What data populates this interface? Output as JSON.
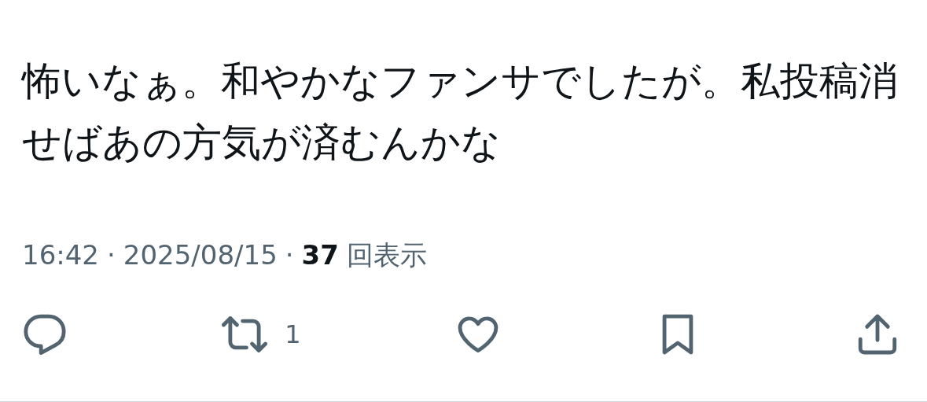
{
  "post": {
    "text": "怖いなぁ。和やかなファンサでしたが。私投稿消せばあの方気が済むんかな"
  },
  "meta": [
    {
      "kind": "time",
      "text": "16:42"
    },
    {
      "kind": "separator",
      "text": "·"
    },
    {
      "kind": "date",
      "text": "2025/08/15"
    },
    {
      "kind": "separator",
      "text": "·"
    },
    {
      "kind": "count",
      "text": "37"
    },
    {
      "kind": "label",
      "text": "回表示"
    }
  ],
  "actions": [
    {
      "kind": "reply"
    },
    {
      "kind": "repost",
      "count": "1"
    },
    {
      "kind": "like"
    },
    {
      "kind": "bookmark"
    },
    {
      "kind": "share"
    }
  ]
}
